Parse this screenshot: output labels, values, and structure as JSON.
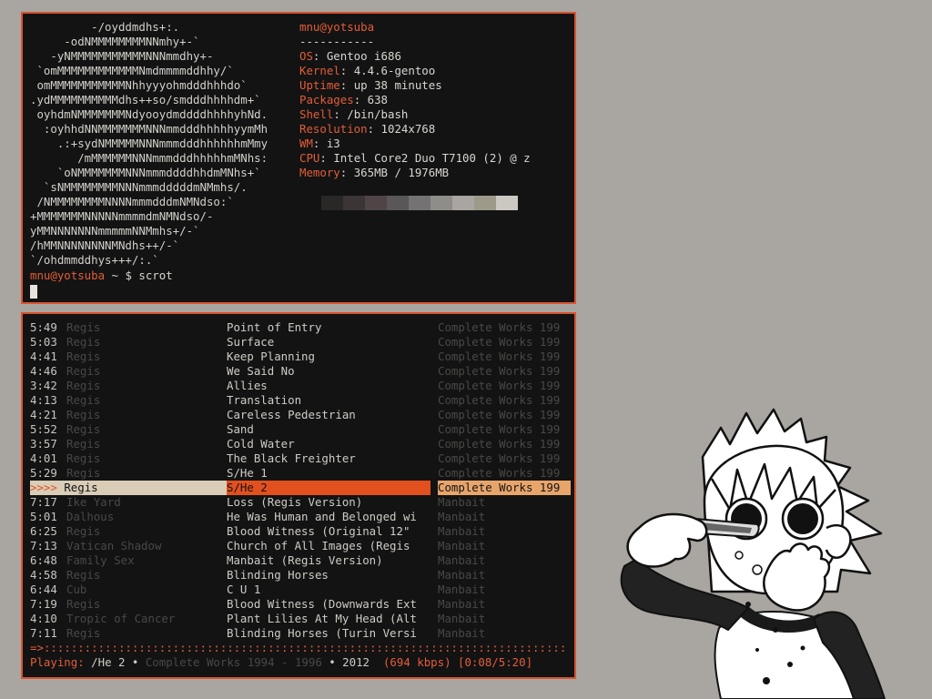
{
  "neofetch": {
    "ascii": [
      "         -/oyddmdhs+:.",
      "     -odNMMMMMMMMNNmhy+-`",
      "   -yNMMMMMMMMMMMNNNmmdhy+-",
      " `omMMMMMMMMMMMMNmdmmmmddhhy/`",
      " omMMMMMMMMMMMNhhyyyohmdddhhhdo`",
      ".ydMMMMMMMMMMdhs++so/smdddhhhhdm+`",
      " oyhdmNMMMMMMMNdyooydmddddhhhhyhNd.",
      "  :oyhhdNNMMMMMMMNNNmmdddhhhhhyymMh",
      "    .:+sydNMMMMMNNNmmmdddhhhhhhmMmy",
      "       /mMMMMMMNNNmmmdddhhhhhmMNhs:",
      "    `oNMMMMMMMNNNmmmddddhhdmMNhs+`",
      "  `sNMMMMMMMMNNNmmmdddddmNMmhs/.",
      " /NMMMMMMMMNNNNmmmdddmNMNdso:`",
      "+MMMMMMMNNNNNmmmmdmNMNdso/-",
      "yMMNNNNNNNmmmmmNNMmhs+/-`",
      "/hMMNNNNNNNNMNdhs++/-`",
      "`/ohdmmddhys+++/:.`"
    ],
    "header": "mnu@yotsuba",
    "separator": "-----------",
    "fields": [
      {
        "key": "OS",
        "value": "Gentoo i686"
      },
      {
        "key": "Kernel",
        "value": "4.4.6-gentoo"
      },
      {
        "key": "Uptime",
        "value": "up 38 minutes"
      },
      {
        "key": "Packages",
        "value": "638"
      },
      {
        "key": "Shell",
        "value": "/bin/bash"
      },
      {
        "key": "Resolution",
        "value": "1024x768"
      },
      {
        "key": "WM",
        "value": "i3"
      },
      {
        "key": "CPU",
        "value": "Intel Core2 Duo T7100 (2) @ z"
      },
      {
        "key": "Memory",
        "value": "365MB / 1976MB"
      }
    ],
    "palette": [
      "#131313",
      "#2a2727",
      "#3b3535",
      "#4f4446",
      "#5a5758",
      "#747272",
      "#8f8d8a",
      "#a9a6a1",
      "#9e9a8a",
      "#cbc8c2"
    ],
    "prompt": {
      "user": "mnu@yotsuba",
      "rest": " ~ $ scrot"
    }
  },
  "cmus": {
    "tracks": [
      {
        "duration": "5:49",
        "artist": "Regis",
        "title": "Point of Entry",
        "album": "Complete Works 199"
      },
      {
        "duration": "5:03",
        "artist": "Regis",
        "title": "Surface",
        "album": "Complete Works 199"
      },
      {
        "duration": "4:41",
        "artist": "Regis",
        "title": "Keep Planning",
        "album": "Complete Works 199"
      },
      {
        "duration": "4:46",
        "artist": "Regis",
        "title": "We Said No",
        "album": "Complete Works 199"
      },
      {
        "duration": "3:42",
        "artist": "Regis",
        "title": "Allies",
        "album": "Complete Works 199"
      },
      {
        "duration": "4:13",
        "artist": "Regis",
        "title": "Translation",
        "album": "Complete Works 199"
      },
      {
        "duration": "4:21",
        "artist": "Regis",
        "title": "Careless Pedestrian",
        "album": "Complete Works 199"
      },
      {
        "duration": "5:52",
        "artist": "Regis",
        "title": "Sand",
        "album": "Complete Works 199"
      },
      {
        "duration": "3:57",
        "artist": "Regis",
        "title": "Cold Water",
        "album": "Complete Works 199"
      },
      {
        "duration": "4:01",
        "artist": "Regis",
        "title": "The Black Freighter",
        "album": "Complete Works 199"
      },
      {
        "duration": "5:29",
        "artist": "Regis",
        "title": "S/He 1",
        "album": "Complete Works 199"
      },
      {
        "duration": "",
        "artist": "Regis",
        "title": "S/He 2",
        "album": "Complete Works 199",
        "selected": true,
        "marker": ">>>>"
      },
      {
        "duration": "7:17",
        "artist": "Ike Yard",
        "title": "Loss (Regis Version)",
        "album": "Manbait"
      },
      {
        "duration": "5:01",
        "artist": "Dalhous",
        "title": "He Was Human and Belonged wi",
        "album": "Manbait"
      },
      {
        "duration": "6:25",
        "artist": "Regis",
        "title": "Blood Witness (Original 12\"",
        "album": "Manbait"
      },
      {
        "duration": "7:13",
        "artist": "Vatican Shadow",
        "title": "Church of All Images (Regis",
        "album": "Manbait"
      },
      {
        "duration": "6:48",
        "artist": "Family Sex",
        "title": "Manbait (Regis Version)",
        "album": "Manbait"
      },
      {
        "duration": "4:58",
        "artist": "Regis",
        "title": "Blinding Horses",
        "album": "Manbait"
      },
      {
        "duration": "6:44",
        "artist": "Cub",
        "title": "C U 1",
        "album": "Manbait"
      },
      {
        "duration": "7:19",
        "artist": "Regis",
        "title": "Blood Witness (Downwards Ext",
        "album": "Manbait"
      },
      {
        "duration": "4:10",
        "artist": "Tropic of Cancer",
        "title": "Plant Lilies At My Head (Alt",
        "album": "Manbait"
      },
      {
        "duration": "7:11",
        "artist": "Regis",
        "title": "Blinding Horses (Turin Versi",
        "album": "Manbait"
      }
    ],
    "separator": "=>:::::::::::::::::::::::::::::::::::::::::::::::::::::::::::::::::::::::::::::::::::::::::",
    "status": {
      "label": "Playing:",
      "track": " /He 2 ",
      "bullet1": "•",
      "album": " Complete Works 1994 - 1996 ",
      "bullet2": "•",
      "year": " 2012  ",
      "bitrate": "(694 kbps) [0:08/5:20]"
    }
  }
}
